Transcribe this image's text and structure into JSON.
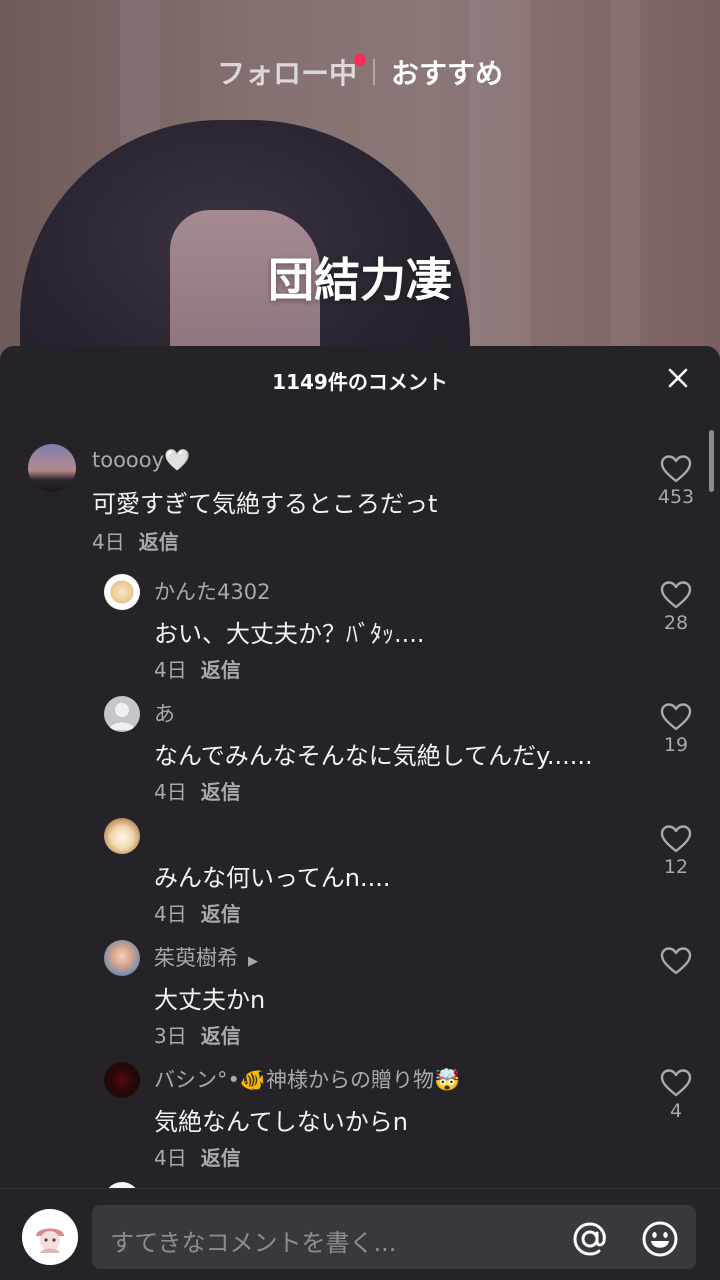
{
  "top_nav": {
    "following_label": "フォロー中",
    "for_you_label": "おすすめ"
  },
  "video": {
    "caption_overlay": "団結力凄"
  },
  "comments_sheet": {
    "title": "1149件のコメント",
    "comments": [
      {
        "username": "tooooy",
        "text": "可愛すぎて気絶するところだっt",
        "date": "4日",
        "reply_label": "返信",
        "likes": "453"
      },
      {
        "username": "かんた4302",
        "text": "おい、大丈夫か？ﾊﾞﾀｯ....",
        "date": "4日",
        "reply_label": "返信",
        "likes": "28"
      },
      {
        "username": "あ",
        "text": "なんでみんなそんなに気絶してんだy......",
        "date": "4日",
        "reply_label": "返信",
        "likes": "19"
      },
      {
        "username": "",
        "text": "みんな何いってんn....",
        "date": "4日",
        "reply_label": "返信",
        "likes": "12"
      },
      {
        "username": "茱萸樹希",
        "text": "大丈夫かn",
        "date": "3日",
        "reply_label": "返信",
        "likes": ""
      },
      {
        "username": "バシン°•🐠神様からの贈り物🤯",
        "text": "気絶なんてしないからn",
        "date": "4日",
        "reply_label": "返信",
        "likes": "4"
      }
    ]
  },
  "input_bar": {
    "placeholder": "すてきなコメントを書く..."
  },
  "colors": {
    "sheet_bg": "#252327",
    "accent_red": "#fe2c55",
    "muted_text": "#a9a8ad"
  },
  "icons": [
    "close-icon",
    "heart-icon",
    "mention-icon",
    "emoji-icon",
    "chevron-right-icon",
    "default-avatar-icon"
  ]
}
